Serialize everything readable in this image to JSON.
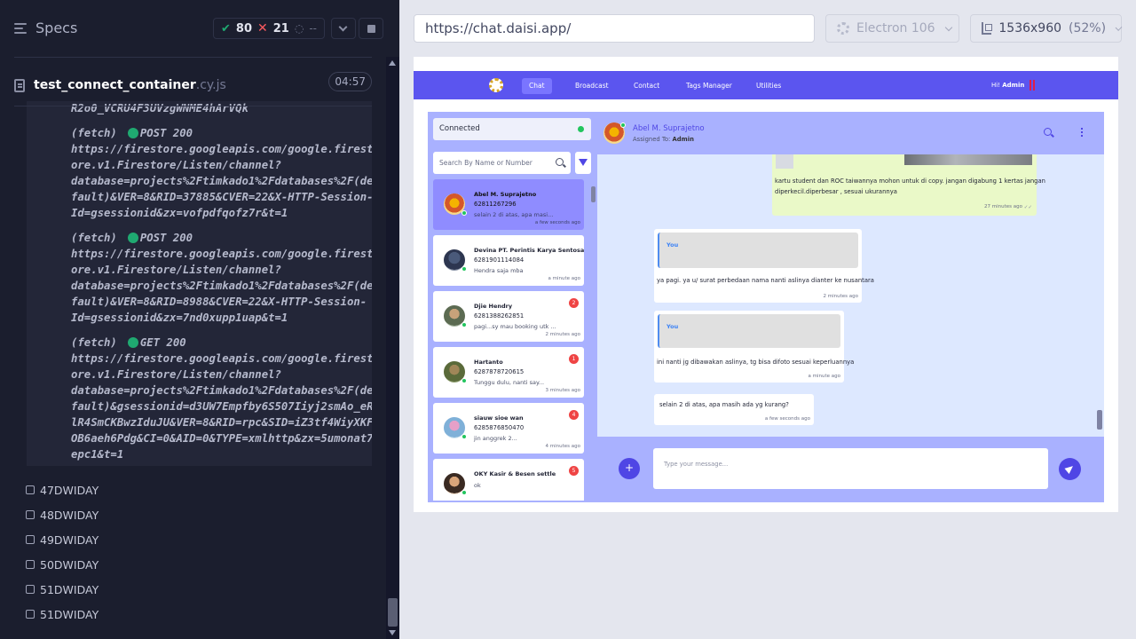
{
  "specs": {
    "title": "Specs",
    "passed": "80",
    "failed": "21",
    "pending": "--",
    "file_name": "test_connect_container",
    "file_ext": ".cy.js",
    "duration": "04:57"
  },
  "log": {
    "first_line": "R2o0_VCRU4F3UVzgWNME4hArVQk",
    "entries": [
      {
        "prefix": "(fetch)",
        "method": "POST 200",
        "lines": [
          "https://firestore.googleapis.com/google.firest",
          "ore.v1.Firestore/Listen/channel?",
          "database=projects%2Ftimkado1%2Fdatabases%2F(de",
          "fault)&VER=8&RID=37885&CVER=22&X-HTTP-Session-",
          "Id=gsessionid&zx=vofpdfqofz7r&t=1"
        ]
      },
      {
        "prefix": "(fetch)",
        "method": "POST 200",
        "lines": [
          "https://firestore.googleapis.com/google.firest",
          "ore.v1.Firestore/Listen/channel?",
          "database=projects%2Ftimkado1%2Fdatabases%2F(de",
          "fault)&VER=8&RID=8988&CVER=22&X-HTTP-Session-",
          "Id=gsessionid&zx=7nd0xupp1uap&t=1"
        ]
      },
      {
        "prefix": "(fetch)",
        "method": "GET 200",
        "lines": [
          "https://firestore.googleapis.com/google.firest",
          "ore.v1.Firestore/Listen/channel?",
          "database=projects%2Ftimkado1%2Fdatabases%2F(de",
          "fault)&gsessionid=d3UW7Empfby6S507Iiyj2smAo_eR",
          "lR4SmCKBwzIduJU&VER=8&RID=rpc&SID=iZ3tf4WiyXKF",
          "OB6aeh6Pdg&CI=0&AID=0&TYPE=xmlhttp&zx=5umonat7",
          "epc1&t=1"
        ]
      }
    ]
  },
  "tests": [
    "47DWIDAY",
    "48DWIDAY",
    "49DWIDAY",
    "50DWIDAY",
    "51DWIDAY",
    "51DWIDAY"
  ],
  "browser": {
    "url": "https://chat.daisi.app/",
    "engine": "Electron 106",
    "viewport": "1536x960",
    "zoom": "(52%)"
  },
  "app": {
    "nav": [
      "Chat",
      "Broadcast",
      "Contact",
      "Tags Manager",
      "Utilities"
    ],
    "greeting_prefix": "Hi!",
    "greeting_user": "Admin",
    "status": "Connected",
    "search_placeholder": "Search By Name or Number",
    "contacts": [
      {
        "name": "Abel M. Suprajetno",
        "phone": "62811267296",
        "msg": "selain 2 di atas, apa masi...",
        "time": "a few seconds ago",
        "badge": ""
      },
      {
        "name": "Devina PT. Perintis Karya Sentosa",
        "phone": "6281901114084",
        "msg": "Hendra saja mba",
        "time": "a minute ago",
        "badge": ""
      },
      {
        "name": "Djie Hendry",
        "phone": "6281388262851",
        "msg": "pagi...sy mau booking utk ...",
        "time": "2 minutes ago",
        "badge": "2"
      },
      {
        "name": "Hartanto",
        "phone": "6287878720615",
        "msg": "Tunggu dulu, nanti say...",
        "time": "3 minutes ago",
        "badge": "1"
      },
      {
        "name": "siauw sioe wan",
        "phone": "6285876850470",
        "msg": "jin anggrek 2...",
        "time": "4 minutes ago",
        "badge": "4"
      },
      {
        "name": "OKY Kasir & Besen settle",
        "phone": "",
        "msg": "ok",
        "time": "",
        "badge": "5"
      }
    ],
    "conversation": {
      "name": "Abel M. Suprajetno",
      "assigned_label": "Assigned To:",
      "assigned_to": "Admin",
      "messages": [
        {
          "text": "kartu student dan ROC taiwannya mohon untuk di copy. jangan digabung 1 kertas jangan",
          "text2": "diperkecil.diperbesar , sesuai ukurannya",
          "time": "27 minutes ago"
        },
        {
          "quote": "You",
          "text": "ya pagi. ya u/ surat perbedaan nama nanti aslinya dianter ke nusantara",
          "time": "2 minutes ago"
        },
        {
          "quote": "You",
          "text": "ini nanti jg dibawakan aslinya, tg bisa difoto sesuai keperluannya",
          "time": "a minute ago"
        },
        {
          "text": "selain 2 di atas, apa masih ada yg kurang?",
          "time": "a few seconds ago"
        }
      ]
    },
    "composer_placeholder": "Type your message..."
  }
}
